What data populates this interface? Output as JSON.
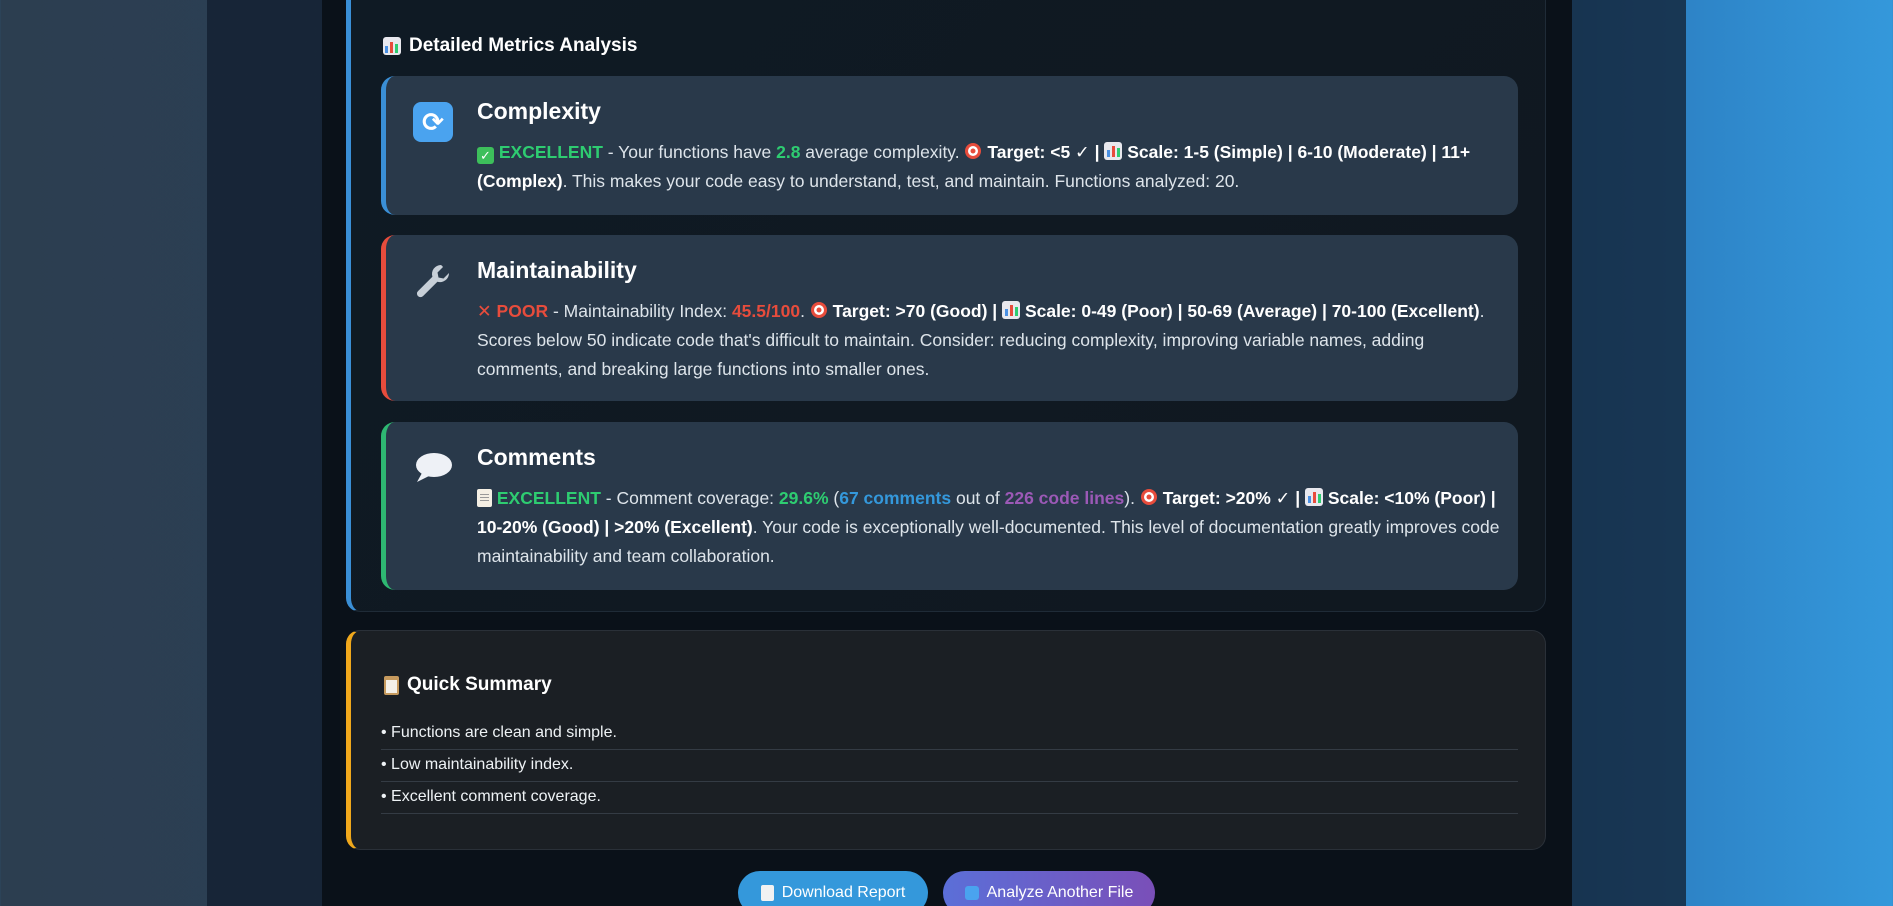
{
  "metrics": {
    "heading": "Detailed Metrics Analysis",
    "complexity": {
      "title": "Complexity",
      "rating": "EXCELLENT",
      "t1": " - Your functions have ",
      "value": "2.8",
      "t2": " average complexity. ",
      "target": "Target: <5 ✓",
      "sep": " | ",
      "scale": "Scale: 1-5 (Simple) | 6-10 (Moderate) | 11+ (Complex)",
      "t3": ". This makes your code easy to understand, test, and maintain. Functions analyzed: 20."
    },
    "maintainability": {
      "title": "Maintainability",
      "rating": "POOR",
      "t1": " - Maintainability Index: ",
      "value": "45.5/100",
      "t2": ". ",
      "target": "Target: >70 (Good)",
      "sep": " | ",
      "scale": "Scale: 0-49 (Poor) | 50-69 (Average) | 70-100 (Excellent)",
      "t3": ". Scores below 50 indicate code that's difficult to maintain. Consider: reducing complexity, improving variable names, adding comments, and breaking large functions into smaller ones."
    },
    "comments": {
      "title": "Comments",
      "rating": "EXCELLENT",
      "t1": " - Comment coverage: ",
      "value": "29.6%",
      "t2": " (",
      "comments_count": "67 comments",
      "t3": " out of ",
      "lines_count": "226 code lines",
      "t4": "). ",
      "target": "Target: >20% ✓",
      "sep": " | ",
      "scale": "Scale: <10% (Poor) | 10-20% (Good) | >20% (Excellent)",
      "t5": ". Your code is exceptionally well-documented. This level of documentation greatly improves code maintainability and team collaboration."
    }
  },
  "summary": {
    "heading": "Quick Summary",
    "items": [
      "• Functions are clean and simple.",
      "• Low maintainability index.",
      "• Excellent comment coverage."
    ]
  },
  "actions": {
    "download": "Download Report",
    "analyze": "Analyze Another File"
  },
  "colors": {
    "excellent": "#2ecc71",
    "poor": "#e74c3c",
    "accent_blue": "#3498db",
    "accent_purple": "#9b59b6",
    "summary_accent": "#f0a81c"
  },
  "icons": {
    "complexity": "refresh-icon",
    "maintainability": "wrench-icon",
    "comments": "speech-bubble-icon"
  }
}
